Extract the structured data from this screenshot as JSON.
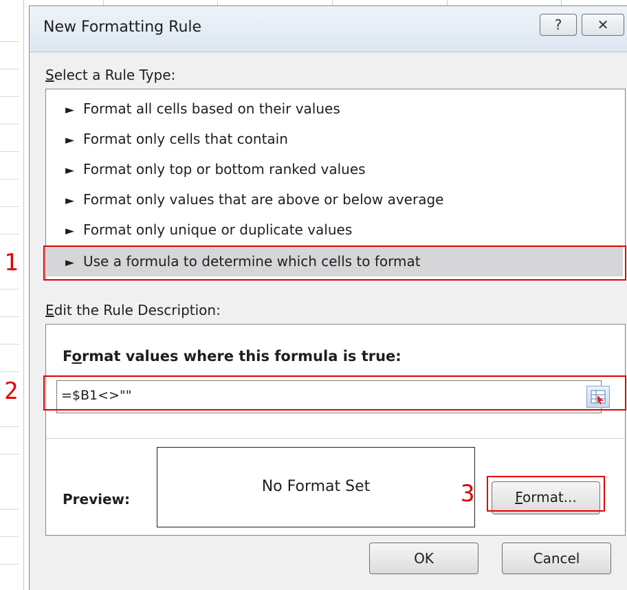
{
  "dialog": {
    "title": "New Formatting Rule",
    "help_symbol": "?",
    "close_symbol": "✕"
  },
  "rule_type": {
    "label_first": "S",
    "label_rest": "elect a Rule Type:",
    "items": [
      {
        "label": "Format all cells based on their values"
      },
      {
        "label": "Format only cells that contain"
      },
      {
        "label": "Format only top or bottom ranked values"
      },
      {
        "label": "Format only values that are above or below average"
      },
      {
        "label": "Format only unique or duplicate values"
      },
      {
        "label": "Use a formula to determine which cells to format"
      }
    ],
    "selected_index": 5,
    "arrow_glyph": "►"
  },
  "description": {
    "label_first": "E",
    "label_rest": "dit the Rule Description:",
    "formula_heading_a": "F",
    "formula_heading_u": "o",
    "formula_heading_b": "rmat values where this formula is true:",
    "formula_value": "=$B1<>\"\"",
    "preview_label": "Preview:",
    "preview_text": "No Format Set",
    "format_button_first": "F",
    "format_button_rest": "ormat..."
  },
  "buttons": {
    "ok": "OK",
    "cancel": "Cancel"
  },
  "callouts": {
    "one": "1",
    "two": "2",
    "three": "3"
  },
  "colors": {
    "annotation_red": "#e00000",
    "selected_row": "#d6d6d9"
  }
}
